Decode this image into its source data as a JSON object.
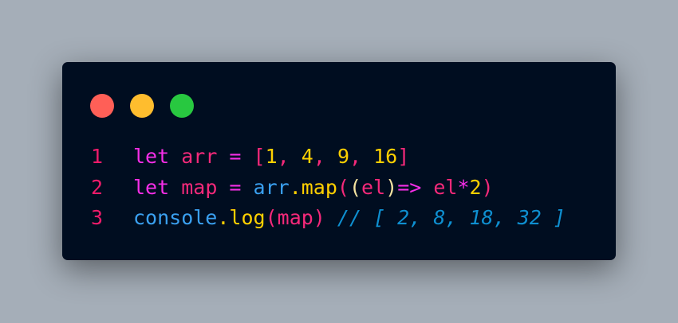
{
  "window_controls": [
    {
      "name": "close",
      "color": "#ff5f57"
    },
    {
      "name": "minimize",
      "color": "#ffbd2e"
    },
    {
      "name": "maximize",
      "color": "#28c840"
    }
  ],
  "colors": {
    "line_number": "#ee1b6a",
    "keyword": "#f72ee8",
    "variable": "#f5297a",
    "number": "#ffd000",
    "method": "#ffd000",
    "object": "#3aa0f0",
    "paren_inner": "#f3e3a0",
    "comment": "#0e8fd0"
  },
  "lines": [
    {
      "number": "1",
      "tokens": [
        {
          "t": "let",
          "c": "keyword"
        },
        {
          "t": " ",
          "c": "keyword"
        },
        {
          "t": "arr",
          "c": "variable"
        },
        {
          "t": " = ",
          "c": "keyword"
        },
        {
          "t": "[",
          "c": "variable"
        },
        {
          "t": "1",
          "c": "number"
        },
        {
          "t": ", ",
          "c": "variable"
        },
        {
          "t": "4",
          "c": "number"
        },
        {
          "t": ", ",
          "c": "variable"
        },
        {
          "t": "9",
          "c": "number"
        },
        {
          "t": ", ",
          "c": "variable"
        },
        {
          "t": "16",
          "c": "number"
        },
        {
          "t": "]",
          "c": "variable"
        }
      ]
    },
    {
      "number": "2",
      "tokens": [
        {
          "t": "let",
          "c": "keyword"
        },
        {
          "t": " ",
          "c": "keyword"
        },
        {
          "t": "map",
          "c": "variable"
        },
        {
          "t": " = ",
          "c": "keyword"
        },
        {
          "t": "arr",
          "c": "object"
        },
        {
          "t": ".",
          "c": "method"
        },
        {
          "t": "map",
          "c": "method"
        },
        {
          "t": "(",
          "c": "variable"
        },
        {
          "t": "(",
          "c": "paren_inner"
        },
        {
          "t": "el",
          "c": "variable"
        },
        {
          "t": ")",
          "c": "paren_inner"
        },
        {
          "t": "=>",
          "c": "keyword"
        },
        {
          "t": " ",
          "c": "keyword"
        },
        {
          "t": "el",
          "c": "variable"
        },
        {
          "t": "*",
          "c": "keyword"
        },
        {
          "t": "2",
          "c": "number"
        },
        {
          "t": ")",
          "c": "variable"
        }
      ]
    },
    {
      "number": "3",
      "tokens": [
        {
          "t": "console",
          "c": "object"
        },
        {
          "t": ".",
          "c": "method"
        },
        {
          "t": "log",
          "c": "method"
        },
        {
          "t": "(",
          "c": "variable"
        },
        {
          "t": "map",
          "c": "variable"
        },
        {
          "t": ")",
          "c": "variable"
        },
        {
          "t": " ",
          "c": "variable"
        },
        {
          "t": "// [ 2, 8, 18, 32 ]",
          "c": "comment",
          "italic": true
        }
      ]
    }
  ]
}
